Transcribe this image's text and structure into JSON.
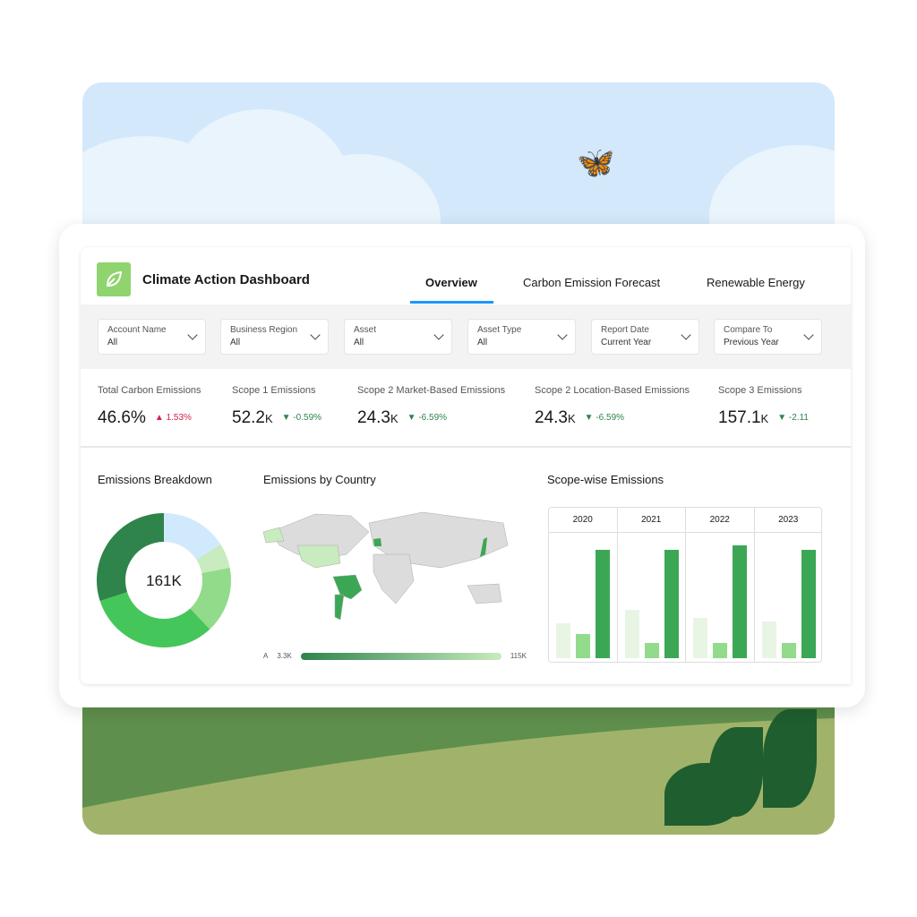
{
  "header": {
    "title": "Climate Action Dashboard",
    "logo_icon": "leaf-icon"
  },
  "tabs": [
    {
      "label": "Overview",
      "active": true
    },
    {
      "label": "Carbon Emission Forecast"
    },
    {
      "label": "Renewable Energy"
    }
  ],
  "filters": [
    {
      "label": "Account Name",
      "value": "All"
    },
    {
      "label": "Business Region",
      "value": "All"
    },
    {
      "label": "Asset",
      "value": "All"
    },
    {
      "label": "Asset Type",
      "value": "All"
    },
    {
      "label": "Report Date",
      "value": "Current Year"
    },
    {
      "label": "Compare To",
      "value": "Previous Year"
    }
  ],
  "kpis": [
    {
      "label": "Total Carbon Emissions",
      "value": "46.6%",
      "unit": "",
      "delta": "1.53%",
      "dir": "up"
    },
    {
      "label": "Scope 1 Emissions",
      "value": "52.2",
      "unit": "K",
      "delta": "-0.59%",
      "dir": "down"
    },
    {
      "label": "Scope 2 Market-Based Emissions",
      "value": "24.3",
      "unit": "K",
      "delta": "-6.59%",
      "dir": "down"
    },
    {
      "label": "Scope 2 Location-Based Emissions",
      "value": "24.3",
      "unit": "K",
      "delta": "-6.59%",
      "dir": "down"
    },
    {
      "label": "Scope 3 Emissions",
      "value": "157.1",
      "unit": "K",
      "delta": "-2.11",
      "dir": "down"
    }
  ],
  "sections": {
    "breakdown": "Emissions Breakdown",
    "country": "Emissions by Country",
    "scope": "Scope-wise Emissions"
  },
  "colors": {
    "up": "#d6204b",
    "down": "#2e844a",
    "accent": "#1b96ff"
  },
  "chart_data": [
    {
      "type": "pie",
      "title": "Emissions Breakdown",
      "center_label": "161K",
      "values": [
        0.16,
        0.06,
        0.16,
        0.32,
        0.3
      ],
      "colors": [
        "#d1e9fd",
        "#c8ebbf",
        "#91db8b",
        "#45c65a",
        "#2e844a"
      ]
    },
    {
      "type": "heatmap",
      "title": "Emissions by Country",
      "legend_prefix": "A",
      "legend_min": "3.3K",
      "legend_max": "115K",
      "highlighted": [
        "United States",
        "Brazil",
        "Argentina",
        "France",
        "Japan"
      ]
    },
    {
      "type": "bar",
      "title": "Scope-wise Emissions",
      "categories": [
        "2020",
        "2021",
        "2022",
        "2023"
      ],
      "series": [
        {
          "values": [
            36,
            50,
            42,
            38
          ],
          "color": "#e8f5e4"
        },
        {
          "values": [
            25,
            16,
            16,
            16
          ],
          "color": "#91db8b"
        },
        {
          "values": [
            112,
            112,
            117,
            112
          ],
          "color": "#3ba755"
        }
      ]
    }
  ]
}
